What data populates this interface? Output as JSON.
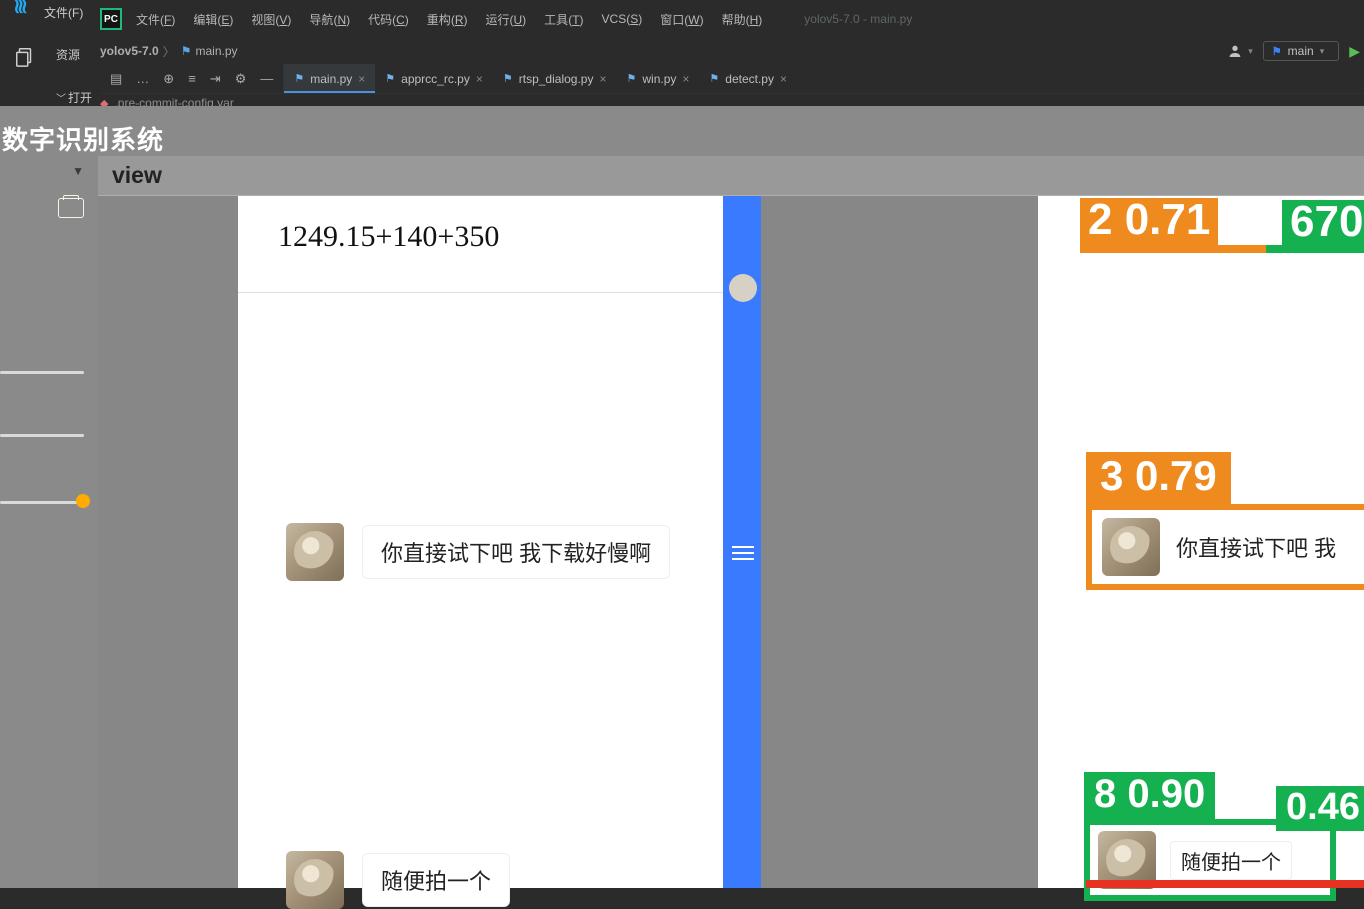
{
  "vscode": {
    "menu_file": "文件(F)"
  },
  "pycharm": {
    "logo": "PC",
    "menus": [
      {
        "l": "文件",
        "u": "F"
      },
      {
        "l": "编辑",
        "u": "E"
      },
      {
        "l": "视图",
        "u": "V"
      },
      {
        "l": "导航",
        "u": "N"
      },
      {
        "l": "代码",
        "u": "C"
      },
      {
        "l": "重构",
        "u": "R"
      },
      {
        "l": "运行",
        "u": "U"
      },
      {
        "l": "工具",
        "u": "T"
      },
      {
        "l": "VCS",
        "u": "S"
      },
      {
        "l": "窗口",
        "u": "W"
      },
      {
        "l": "帮助",
        "u": "H"
      }
    ],
    "title_file": "yolov5-7.0 - main.py",
    "breadcrumb": {
      "project": "yolov5-7.0",
      "file": "main.py"
    },
    "tabs": [
      {
        "name": "main.py",
        "active": true
      },
      {
        "name": "apprcc_rc.py",
        "active": false
      },
      {
        "name": "rtsp_dialog.py",
        "active": false
      },
      {
        "name": "win.py",
        "active": false
      },
      {
        "name": "detect.py",
        "active": false
      }
    ],
    "run_config": "main",
    "subline": ".pre-commit-config.yar",
    "side_label_explorer": "资源",
    "side_label_open": "打开"
  },
  "app": {
    "title": "数字识别系统",
    "view_label": "view",
    "equation": "1249.15+140+350",
    "message1": "你直接试下吧 我下载好慢啊",
    "message2": "随便拍一个",
    "det_top_a": "2 0.71",
    "det_top_b": "670",
    "det_mid_label": "3 0.79",
    "det_mid_msg": "你直接试下吧 我",
    "det_bot_label8": "8 0.90",
    "det_bot_label46": "0.46",
    "det_bot_msg": "随便拍一个"
  }
}
